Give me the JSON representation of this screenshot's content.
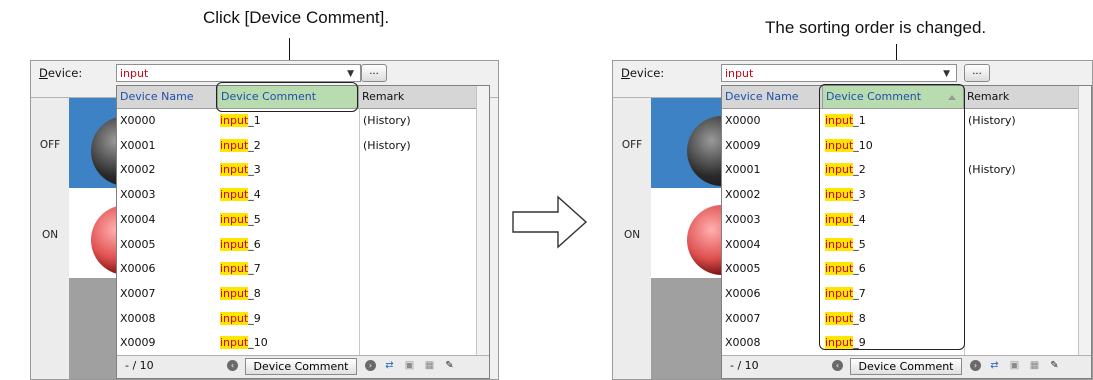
{
  "captions": {
    "left": "Click [Device Comment].",
    "right": "The sorting order is changed."
  },
  "panels": {
    "device_label": "Device:",
    "device_value": "input",
    "ellipsis_label": "...",
    "state_off": "OFF",
    "state_on": "ON",
    "columns": {
      "name": "Device Name",
      "comment": "Device Comment",
      "remark": "Remark"
    },
    "footer": {
      "count": "- / 10",
      "sort_button": "Device Comment"
    }
  },
  "highlight_text": "input",
  "before": {
    "rows": [
      {
        "name": "X0000",
        "suffix": "_1",
        "remark": "(History)"
      },
      {
        "name": "X0001",
        "suffix": "_2",
        "remark": "(History)"
      },
      {
        "name": "X0002",
        "suffix": "_3",
        "remark": ""
      },
      {
        "name": "X0003",
        "suffix": "_4",
        "remark": ""
      },
      {
        "name": "X0004",
        "suffix": "_5",
        "remark": ""
      },
      {
        "name": "X0005",
        "suffix": "_6",
        "remark": ""
      },
      {
        "name": "X0006",
        "suffix": "_7",
        "remark": ""
      },
      {
        "name": "X0007",
        "suffix": "_8",
        "remark": ""
      },
      {
        "name": "X0008",
        "suffix": "_9",
        "remark": ""
      },
      {
        "name": "X0009",
        "suffix": "_10",
        "remark": ""
      }
    ]
  },
  "after": {
    "rows": [
      {
        "name": "X0000",
        "suffix": "_1",
        "remark": "(History)"
      },
      {
        "name": "X0009",
        "suffix": "_10",
        "remark": ""
      },
      {
        "name": "X0001",
        "suffix": "_2",
        "remark": "(History)"
      },
      {
        "name": "X0002",
        "suffix": "_3",
        "remark": ""
      },
      {
        "name": "X0003",
        "suffix": "_4",
        "remark": ""
      },
      {
        "name": "X0004",
        "suffix": "_5",
        "remark": ""
      },
      {
        "name": "X0005",
        "suffix": "_6",
        "remark": ""
      },
      {
        "name": "X0006",
        "suffix": "_7",
        "remark": ""
      },
      {
        "name": "X0007",
        "suffix": "_8",
        "remark": ""
      },
      {
        "name": "X0008",
        "suffix": "_9",
        "remark": ""
      }
    ]
  },
  "colors": {
    "highlight_bg": "#ffe600",
    "highlight_text": "#d0021b",
    "header_link": "#1f4fa8",
    "sorted_header": "#b8dcb0",
    "state_blue": "#3d82c4"
  },
  "icons": [
    "arrow-right-outline-icon",
    "sort-ascending-icon",
    "dropdown-arrow-icon",
    "prev-circle-icon",
    "next-circle-icon",
    "copy-device-icon",
    "paste-device-icon",
    "display-format-icon",
    "wrench-icon"
  ]
}
